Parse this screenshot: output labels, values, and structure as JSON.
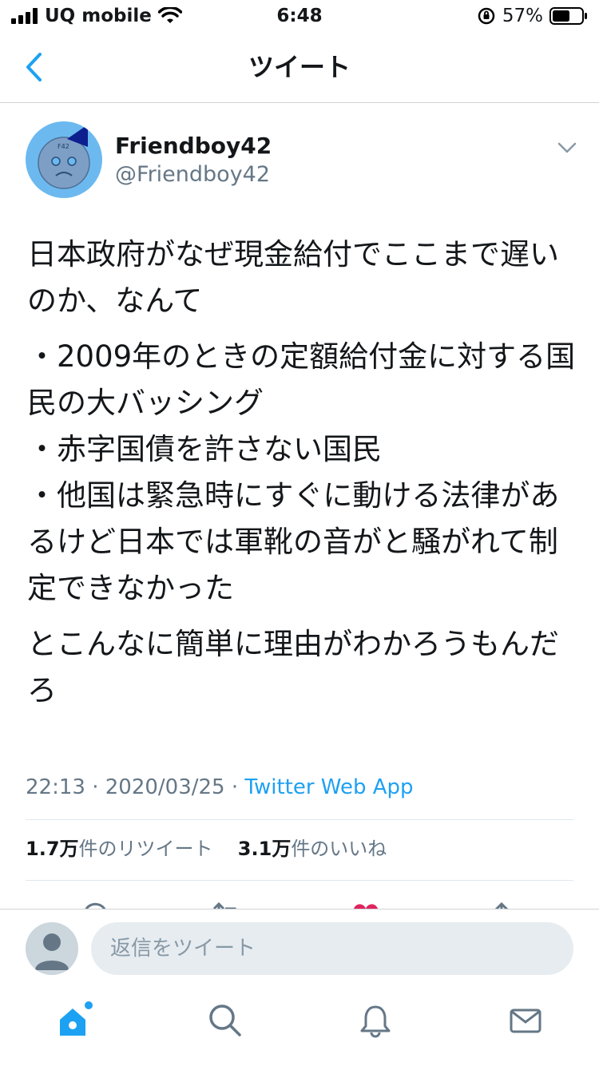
{
  "status": {
    "carrier": "UQ mobile",
    "time": "6:48",
    "battery": "57%",
    "icons": [
      "signal-icon",
      "wifi-icon",
      "rotation-lock-icon",
      "battery-icon"
    ]
  },
  "nav": {
    "title": "ツイート",
    "back_icon": "chevron-left-icon"
  },
  "author": {
    "name": "Friendboy42",
    "handle": "@Friendboy42",
    "avatar_label": "F42"
  },
  "tweet": {
    "paragraphs": [
      "日本政府がなぜ現金給付でここまで遅いのか、なんて",
      "・2009年のときの定額給付金に対する国民の大バッシング\n・赤字国債を許さない国民\n・他国は緊急時にすぐに動ける法律があるけど日本では軍靴の音がと騒がれて制定できなかった",
      "とこんなに簡単に理由がわかろうもんだろ"
    ],
    "time": "22:13",
    "date": "2020/03/25",
    "separator": "·",
    "source": "Twitter Web App"
  },
  "stats": {
    "retweets_count": "1.7万",
    "retweets_label": "件のリツイート",
    "likes_count": "3.1万",
    "likes_label": "件のいいね"
  },
  "actions": [
    "reply-icon",
    "retweet-icon",
    "like-icon",
    "share-icon"
  ],
  "reply": {
    "placeholder": "返信をツイート"
  },
  "tabbar": {
    "items": [
      "home-icon",
      "search-icon",
      "notifications-icon",
      "messages-icon"
    ]
  },
  "colors": {
    "accent": "#1da1f2",
    "text": "#14171a",
    "secondary": "#657786",
    "like": "#e0245e",
    "avatar_bg": "#6cb9f0",
    "avatar_face": "#7d9fc6",
    "avatar_hat": "#0d1f8f"
  }
}
